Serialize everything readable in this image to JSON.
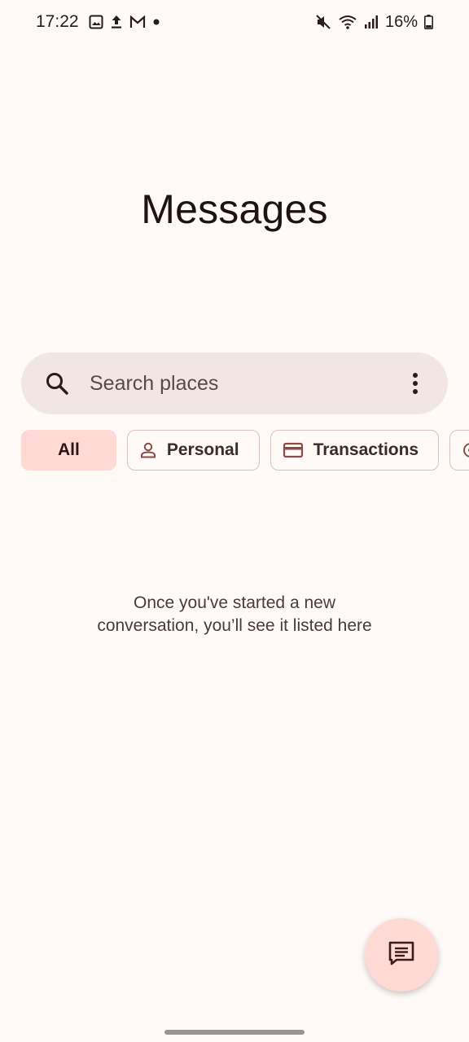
{
  "status_bar": {
    "time": "17:22",
    "battery": "16%",
    "left_icons": [
      "image-icon",
      "upload-icon",
      "gmail-icon",
      "dot-icon"
    ],
    "right_icons": [
      "mute-icon",
      "wifi-icon",
      "signal-icon",
      "battery-icon"
    ]
  },
  "app": {
    "title": "Messages"
  },
  "search": {
    "placeholder": "Search places",
    "value": ""
  },
  "filters": [
    {
      "label": "All",
      "icon": null,
      "selected": true
    },
    {
      "label": "Personal",
      "icon": "person-icon",
      "selected": false
    },
    {
      "label": "Transactions",
      "icon": "card-icon",
      "selected": false
    },
    {
      "label": "",
      "icon": "partial-chip-icon",
      "selected": false
    }
  ],
  "empty_state": {
    "line1": "Once you've started a new",
    "line2": "conversation, you’ll see it listed here"
  },
  "fab": {
    "icon": "compose-message-icon"
  },
  "colors": {
    "background": "#fffaf8",
    "search_bg": "#f2e6e3",
    "chip_selected": "#ffdad5",
    "chip_border": "#d9c2bd",
    "icon_accent": "#8c4a43"
  }
}
